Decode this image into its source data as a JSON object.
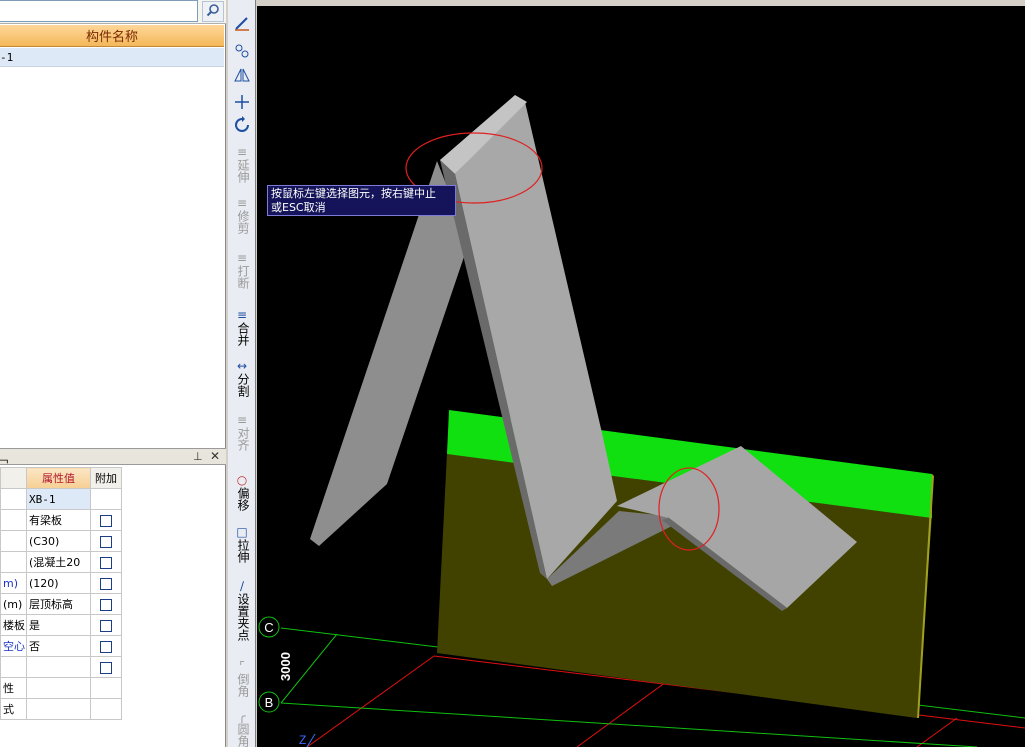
{
  "left_panel": {
    "search": {
      "value": "",
      "placeholder": ""
    },
    "component_list": {
      "header": "构件名称",
      "rows": [
        "-1"
      ]
    },
    "properties": {
      "title": "性",
      "headers": {
        "name": "",
        "value": "属性值",
        "add": "附加"
      },
      "rows": [
        {
          "name": "",
          "name_color": "black",
          "value": "XB-1",
          "has_checkbox": false
        },
        {
          "name": "",
          "name_color": "black",
          "value": "有梁板",
          "has_checkbox": true
        },
        {
          "name": "",
          "name_color": "black",
          "value": "(C30)",
          "has_checkbox": true
        },
        {
          "name": "",
          "name_color": "black",
          "value": "(混凝土20",
          "has_checkbox": true
        },
        {
          "name": "m)",
          "name_color": "blue",
          "value": "(120)",
          "has_checkbox": true
        },
        {
          "name": "(m)",
          "name_color": "black",
          "value": "层顶标高",
          "has_checkbox": true
        },
        {
          "name": "楼板",
          "name_color": "black",
          "value": "是",
          "has_checkbox": true
        },
        {
          "name": "空心",
          "name_color": "blue",
          "value": "否",
          "has_checkbox": true
        },
        {
          "name": "",
          "name_color": "black",
          "value": "",
          "has_checkbox": true
        },
        {
          "name": "性",
          "name_color": "black",
          "value": "",
          "has_checkbox": false
        },
        {
          "name": "式",
          "name_color": "black",
          "value": "",
          "has_checkbox": false
        }
      ]
    }
  },
  "toolbar": {
    "extend": "延伸",
    "trim": "修剪",
    "break": "打断",
    "merge": "合并",
    "split": "分割",
    "align": "对齐",
    "offset": "偏移",
    "stretch": "拉伸",
    "set_grip": "设置夹点",
    "chamfer": "倒角",
    "fillet": "圆角"
  },
  "viewport": {
    "tooltip_line1": "按鼠标左键选择图元，按右键中止",
    "tooltip_line2": "或ESC取消",
    "axis_c": "C",
    "axis_b": "B",
    "dimension": "3000",
    "axis_z": "Z"
  },
  "colors": {
    "background": "#000000",
    "slab": "#a9a9a9",
    "wall_top": "#10e010",
    "wall_face": "#424200",
    "selection_circle": "#e02020",
    "grid_red": "#e01010",
    "grid_green": "#10c010"
  }
}
